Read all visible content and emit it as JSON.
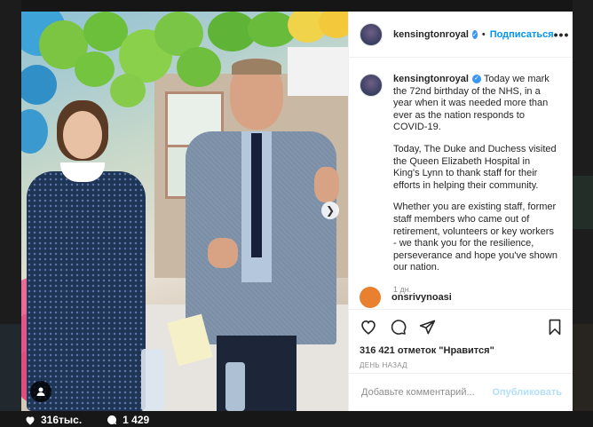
{
  "post": {
    "username": "kensingtonroyal",
    "follow_label": "Подписаться",
    "dot": "•",
    "caption_paragraphs": [
      "Today we mark the 72nd birthday of the NHS, in a year when it was needed more than ever as the nation responds to COVID-19.",
      "Today, The Duke and Duchess visited the Queen Elizabeth Hospital in King's Lynn to thank staff for their efforts in helping their community.",
      "Whether you are existing staff, former staff members who came out of retirement, volunteers or key workers - we thank you for the resilience, perseverance and hope you've shown our nation."
    ],
    "time_ago": "1 дн.",
    "next_comment_user": "onsrivynoasi",
    "likes": "316 421 отметок \"Нравится\"",
    "posted_when": "ДЕНЬ НАЗАД",
    "comment_placeholder": "Добавьте комментарий...",
    "publish_label": "Опубликовать"
  },
  "background_feed": {
    "likes_count": "316тыс.",
    "comments_count": "1 429"
  },
  "colors": {
    "accent": "#0095f6",
    "verified": "#3897f0",
    "publish_disabled": "#b2dffc"
  },
  "icons": [
    "more-options-icon",
    "heart-icon",
    "comment-icon",
    "share-icon",
    "bookmark-icon",
    "verified-badge-icon",
    "next-photo-icon",
    "tag-user-icon"
  ]
}
